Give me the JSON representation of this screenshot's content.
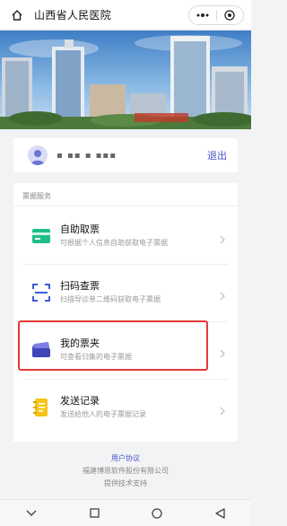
{
  "header": {
    "title": "山西省人民医院"
  },
  "user": {
    "masked_name": "▪ ▪▪ ▪ ▪▪▪",
    "logout_label": "退出"
  },
  "services": {
    "section_title": "票据服务",
    "items": [
      {
        "name": "自助取票",
        "desc": "可根据个人信息自助获取电子票据",
        "icon": "card-icon",
        "color": "#1ebd8a"
      },
      {
        "name": "扫码查票",
        "desc": "扫描导诊单二维码获取电子票据",
        "icon": "scan-icon",
        "color": "#3a5bd9"
      },
      {
        "name": "我的票夹",
        "desc": "可查看归集的电子票据",
        "icon": "folder-icon",
        "color": "#4a4fc4"
      },
      {
        "name": "发送记录",
        "desc": "发送给他人的电子票据记录",
        "icon": "record-icon",
        "color": "#f5c518"
      }
    ]
  },
  "footer": {
    "agreement": "用户协议",
    "company": "福建博思软件股份有限公司",
    "support": "提供技术支持"
  },
  "colors": {
    "accent": "#4a55c8",
    "highlight": "#e53935"
  }
}
